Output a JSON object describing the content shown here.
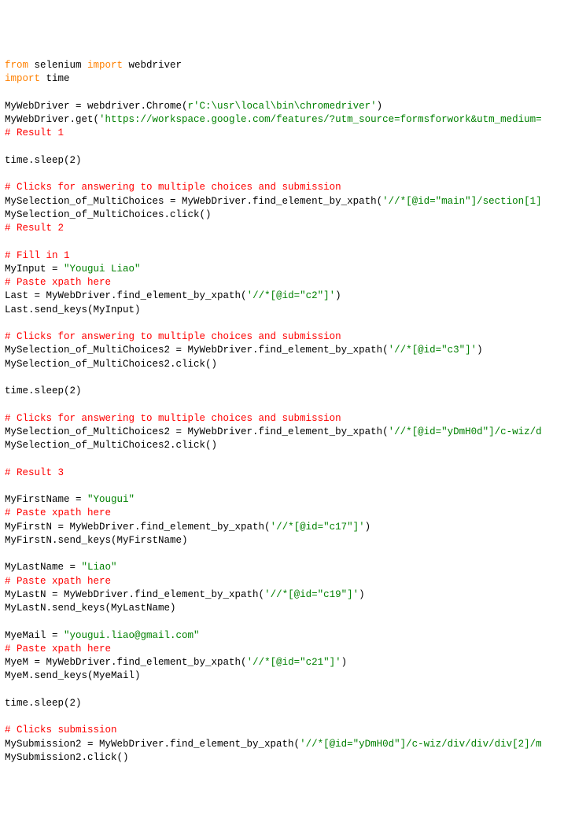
{
  "code": {
    "lines": [
      {
        "parts": [
          {
            "t": "from",
            "c": "kw"
          },
          {
            "t": " selenium "
          },
          {
            "t": "import",
            "c": "kw"
          },
          {
            "t": " webdriver"
          }
        ]
      },
      {
        "parts": [
          {
            "t": "import",
            "c": "kw"
          },
          {
            "t": " time"
          }
        ]
      },
      {
        "parts": [
          {
            "t": ""
          }
        ]
      },
      {
        "parts": [
          {
            "t": "MyWebDriver = webdriver.Chrome("
          },
          {
            "t": "r'C:\\usr\\local\\bin\\chromedriver'",
            "c": "str"
          },
          {
            "t": ")"
          }
        ]
      },
      {
        "parts": [
          {
            "t": "MyWebDriver.get("
          },
          {
            "t": "'https://workspace.google.com/features/?utm_source=formsforwork&utm_medium=",
            "c": "str"
          }
        ]
      },
      {
        "parts": [
          {
            "t": "# Result 1",
            "c": "cmt"
          }
        ]
      },
      {
        "parts": [
          {
            "t": ""
          }
        ]
      },
      {
        "parts": [
          {
            "t": "time.sleep(2)"
          }
        ]
      },
      {
        "parts": [
          {
            "t": ""
          }
        ]
      },
      {
        "parts": [
          {
            "t": "# Clicks for answering to multiple choices and submission",
            "c": "cmt"
          }
        ]
      },
      {
        "parts": [
          {
            "t": "MySelection_of_MultiChoices = MyWebDriver.find_element_by_xpath("
          },
          {
            "t": "'//*[@id=\"main\"]/section[1]",
            "c": "str"
          }
        ]
      },
      {
        "parts": [
          {
            "t": "MySelection_of_MultiChoices.click()"
          }
        ]
      },
      {
        "parts": [
          {
            "t": "# Result 2",
            "c": "cmt"
          }
        ]
      },
      {
        "parts": [
          {
            "t": ""
          }
        ]
      },
      {
        "parts": [
          {
            "t": "# Fill in 1",
            "c": "cmt"
          }
        ]
      },
      {
        "parts": [
          {
            "t": "MyInput = "
          },
          {
            "t": "\"Yougui Liao\"",
            "c": "str"
          }
        ]
      },
      {
        "parts": [
          {
            "t": "# Paste xpath here",
            "c": "cmt"
          }
        ]
      },
      {
        "parts": [
          {
            "t": "Last = MyWebDriver.find_element_by_xpath("
          },
          {
            "t": "'//*[@id=\"c2\"]'",
            "c": "str"
          },
          {
            "t": ")"
          }
        ]
      },
      {
        "parts": [
          {
            "t": "Last.send_keys(MyInput)"
          }
        ]
      },
      {
        "parts": [
          {
            "t": ""
          }
        ]
      },
      {
        "parts": [
          {
            "t": "# Clicks for answering to multiple choices and submission",
            "c": "cmt"
          }
        ]
      },
      {
        "parts": [
          {
            "t": "MySelection_of_MultiChoices2 = MyWebDriver.find_element_by_xpath("
          },
          {
            "t": "'//*[@id=\"c3\"]'",
            "c": "str"
          },
          {
            "t": ")"
          }
        ]
      },
      {
        "parts": [
          {
            "t": "MySelection_of_MultiChoices2.click()"
          }
        ]
      },
      {
        "parts": [
          {
            "t": ""
          }
        ]
      },
      {
        "parts": [
          {
            "t": "time.sleep(2)"
          }
        ]
      },
      {
        "parts": [
          {
            "t": ""
          }
        ]
      },
      {
        "parts": [
          {
            "t": "# Clicks for answering to multiple choices and submission",
            "c": "cmt"
          }
        ]
      },
      {
        "parts": [
          {
            "t": "MySelection_of_MultiChoices2 = MyWebDriver.find_element_by_xpath("
          },
          {
            "t": "'//*[@id=\"yDmH0d\"]/c-wiz/d",
            "c": "str"
          }
        ]
      },
      {
        "parts": [
          {
            "t": "MySelection_of_MultiChoices2.click()"
          }
        ]
      },
      {
        "parts": [
          {
            "t": ""
          }
        ]
      },
      {
        "parts": [
          {
            "t": "# Result 3",
            "c": "cmt"
          }
        ]
      },
      {
        "parts": [
          {
            "t": ""
          }
        ]
      },
      {
        "parts": [
          {
            "t": "MyFirstName = "
          },
          {
            "t": "\"Yougui\"",
            "c": "str"
          }
        ]
      },
      {
        "parts": [
          {
            "t": "# Paste xpath here",
            "c": "cmt"
          }
        ]
      },
      {
        "parts": [
          {
            "t": "MyFirstN = MyWebDriver.find_element_by_xpath("
          },
          {
            "t": "'//*[@id=\"c17\"]'",
            "c": "str"
          },
          {
            "t": ")"
          }
        ]
      },
      {
        "parts": [
          {
            "t": "MyFirstN.send_keys(MyFirstName)"
          }
        ]
      },
      {
        "parts": [
          {
            "t": ""
          }
        ]
      },
      {
        "parts": [
          {
            "t": "MyLastName = "
          },
          {
            "t": "\"Liao\"",
            "c": "str"
          }
        ]
      },
      {
        "parts": [
          {
            "t": "# Paste xpath here",
            "c": "cmt"
          }
        ]
      },
      {
        "parts": [
          {
            "t": "MyLastN = MyWebDriver.find_element_by_xpath("
          },
          {
            "t": "'//*[@id=\"c19\"]'",
            "c": "str"
          },
          {
            "t": ")"
          }
        ]
      },
      {
        "parts": [
          {
            "t": "MyLastN.send_keys(MyLastName)"
          }
        ]
      },
      {
        "parts": [
          {
            "t": ""
          }
        ]
      },
      {
        "parts": [
          {
            "t": "MyeMail = "
          },
          {
            "t": "\"yougui.liao@gmail.com\"",
            "c": "str"
          }
        ]
      },
      {
        "parts": [
          {
            "t": "# Paste xpath here",
            "c": "cmt"
          }
        ]
      },
      {
        "parts": [
          {
            "t": "MyeM = MyWebDriver.find_element_by_xpath("
          },
          {
            "t": "'//*[@id=\"c21\"]'",
            "c": "str"
          },
          {
            "t": ")"
          }
        ]
      },
      {
        "parts": [
          {
            "t": "MyeM.send_keys(MyeMail)"
          }
        ]
      },
      {
        "parts": [
          {
            "t": ""
          }
        ]
      },
      {
        "parts": [
          {
            "t": "time.sleep(2)"
          }
        ]
      },
      {
        "parts": [
          {
            "t": ""
          }
        ]
      },
      {
        "parts": [
          {
            "t": "# Clicks submission",
            "c": "cmt"
          }
        ]
      },
      {
        "parts": [
          {
            "t": "MySubmission2 = MyWebDriver.find_element_by_xpath("
          },
          {
            "t": "'//*[@id=\"yDmH0d\"]/c-wiz/div/div/div[2]/m",
            "c": "str"
          }
        ]
      },
      {
        "parts": [
          {
            "t": "MySubmission2.click()"
          }
        ]
      }
    ]
  }
}
